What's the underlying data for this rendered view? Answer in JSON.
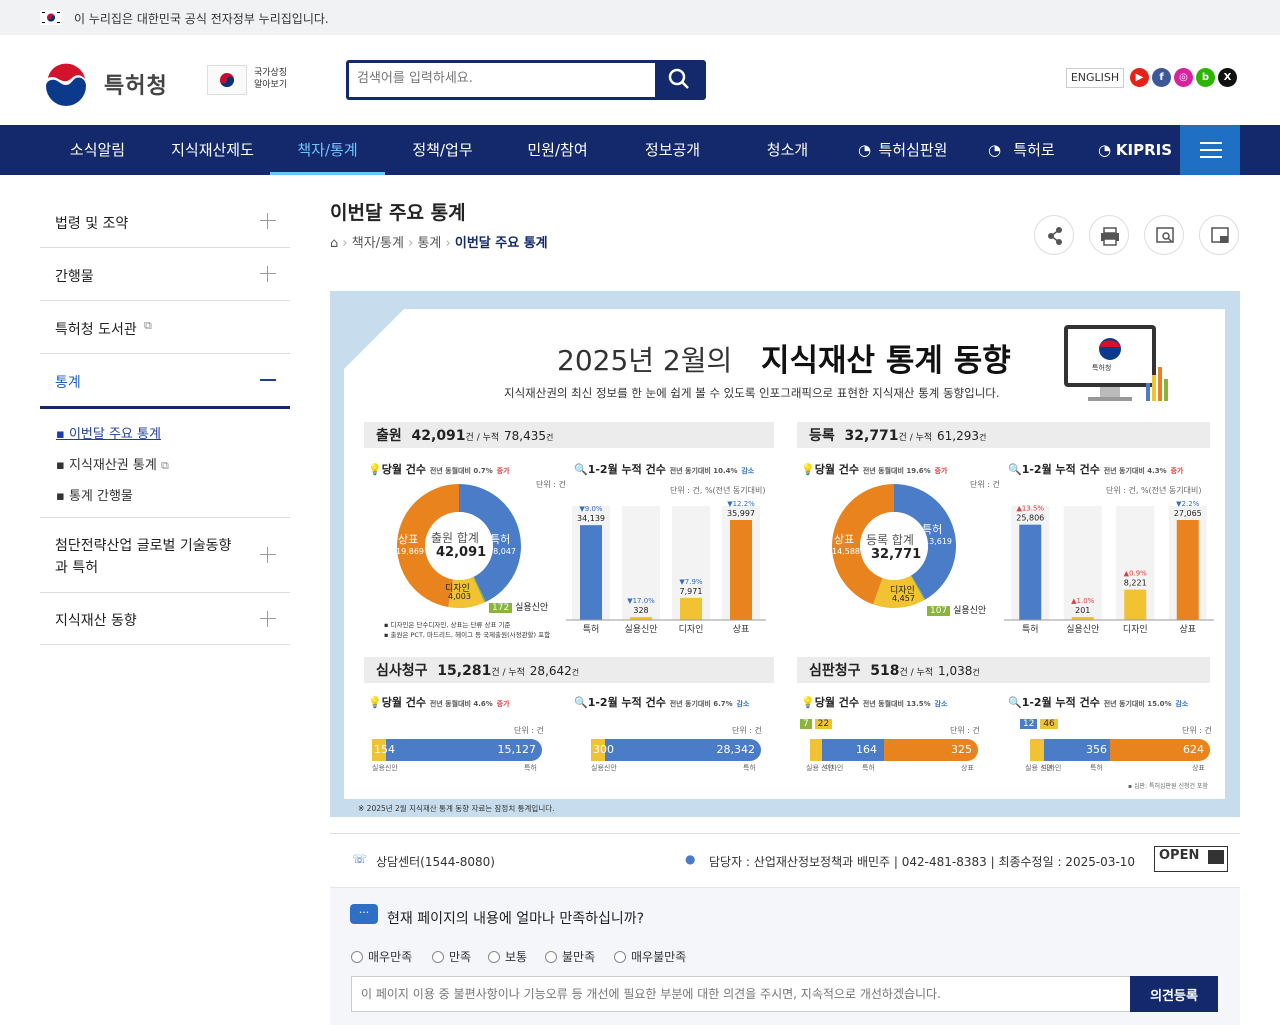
{
  "govbar": {
    "text": "이 누리집은 대한민국 공식 전자정부 누리집입니다."
  },
  "header": {
    "logo_text": "특허청",
    "symbol_text_1": "국가상징",
    "symbol_text_2": "알아보기",
    "search_placeholder": "검색어를 입력하세요.",
    "english": "ENGLISH"
  },
  "nav": {
    "items": [
      "소식알림",
      "지식재산제도",
      "책자/통계",
      "정책/업무",
      "민원/참여",
      "정보공개",
      "청소개",
      "특허심판원",
      "특허로",
      "KIPRIS"
    ]
  },
  "sidebar": {
    "items": [
      "법령 및 조약",
      "간행물",
      "특허청 도서관",
      "통계",
      "첨단전략산업 글로벌 기술동향",
      "과 특허",
      "지식재산 동향"
    ],
    "sub": [
      "이번달 주요 통계",
      "지식재산권 통계",
      "통계 간행물"
    ]
  },
  "page": {
    "title": "이번달 주요 통계",
    "crumb": [
      "책자/통계",
      "통계",
      "이번달 주요 통계"
    ]
  },
  "info": {
    "headline_a": "2025년  2월의",
    "headline_b": "지식재산 통계 동향",
    "desc": "지식재산권의 최신 정보를 한 눈에 쉽게 볼 수 있도록 인포그래픽으로 표현한 지식재산 통계 동향입니다.",
    "monitor_label": "특허청",
    "s1": {
      "name": "출원",
      "total": "42,091",
      "unit": "건 / 누적",
      "cum": "78,435",
      "cumunit": "건"
    },
    "s2": {
      "name": "등록",
      "total": "32,771",
      "unit": "건 / 누적",
      "cum": "61,293",
      "cumunit": "건"
    },
    "s3": {
      "name": "심사청구",
      "total": "15,281",
      "unit": "건 / 누적",
      "cum": "28,642",
      "cumunit": "건"
    },
    "s4": {
      "name": "심판청구",
      "total": "518",
      "unit": "건 / 누적",
      "cum": "1,038",
      "cumunit": "건"
    },
    "month": "당월 건수",
    "cum_label": "1-2월 누적 건수",
    "unit_small": "단위 : 건",
    "unit_pct": "단위 : 건, %(전년 동기대비)",
    "s1_month_tag": "전년 동월대비 0.7%",
    "s1_cum_tag": "전년 동기대비 10.4%",
    "s2_month_tag": "전년 동월대비 19.6%",
    "s2_cum_tag": "전년 동기대비 4.3%",
    "s3_month_tag": "전년 동월대비 4.6%",
    "s3_cum_tag": "전년 동기대비 6.7%",
    "s4_month_tag": "전년 동월대비 13.5%",
    "s4_cum_tag": "전년 동기대비 15.0%",
    "inc": "증가",
    "dec": "감소",
    "donut1": {
      "center": "출원 합계",
      "total": "42,091",
      "trademark": "상표",
      "trademark_v": "19,869",
      "patent": "특허",
      "patent_v": "18,047",
      "design": "디자인",
      "design_v": "4,003",
      "utility": "실용신안",
      "utility_v": "172"
    },
    "donut2": {
      "center": "등록 합계",
      "total": "32,771",
      "trademark": "상표",
      "trademark_v": "14,588",
      "patent": "특허",
      "patent_v": "13,619",
      "design": "디자인",
      "design_v": "4,457",
      "utility": "실용신안",
      "utility_v": "107"
    },
    "note1a": "디자인은 단수디자인, 상표는 단류 상표 기준",
    "note1b": "출원은 PCT, 마드리드, 헤이그 등 국제출원(사정관할) 포함",
    "bars1": {
      "labels": [
        "특허",
        "실용신안",
        "디자인",
        "상표"
      ],
      "values": [
        34139,
        328,
        7971,
        35997
      ],
      "values_txt": [
        "34,139",
        "328",
        "7,971",
        "35,997"
      ],
      "pct": [
        "▼9.0%",
        "▼17.0%",
        "▼7.9%",
        "▼12.2%"
      ]
    },
    "bars2": {
      "labels": [
        "특허",
        "실용신안",
        "디자인",
        "상표"
      ],
      "values": [
        25806,
        201,
        8221,
        27065
      ],
      "values_txt": [
        "25,806",
        "201",
        "8,221",
        "27,065"
      ],
      "pct": [
        "▲13.5%",
        "▲1.0%",
        "▲0.9%",
        "▼2.2%"
      ]
    },
    "hb1": {
      "a": "154",
      "b": "15,127",
      "la": "실용신안",
      "lb": "특허"
    },
    "hb2": {
      "a": "300",
      "b": "28,342",
      "la": "실용신안",
      "lb": "특허"
    },
    "hb3": {
      "a": "7",
      "b": "22",
      "c": "164",
      "d": "325",
      "la": "실용 신안",
      "lb": "디자인",
      "lc": "특허",
      "ld": "상표"
    },
    "hb4": {
      "a": "12",
      "b": "46",
      "c": "356",
      "d": "624",
      "la": "실용 신안",
      "lb": "디자인",
      "lc": "특허",
      "ld": "상표"
    },
    "legend_s4": "심판: 특허심판원 신청건 포함",
    "footnote": "※ 2025년 2월 지식재산 통계 동향 자료는 잠정치 통계입니다."
  },
  "footer": {
    "contact": "상담센터(1544-8080)",
    "manager": "담당자 : 산업재산정보정책과 배민주 | 042-481-8383 | 최종수정일 : 2025-03-10",
    "survey_q": "현재 페이지의 내용에 얼마나 만족하십니까?",
    "options": [
      "매우만족",
      "만족",
      "보통",
      "불만족",
      "매우불만족"
    ],
    "opinion_placeholder": "이 페이지 이용 중 불편사항이나 기능오류 등 개선에 필요한 부분에 대한 의견을 주시면, 지속적으로 개선하겠습니다.",
    "submit": "의견등록",
    "open": "OPEN"
  },
  "colors": {
    "navy": "#13296b",
    "orange": "#e8831e",
    "blue": "#4a7cc8",
    "yellow": "#f1c232",
    "green": "#8bb43a"
  }
}
